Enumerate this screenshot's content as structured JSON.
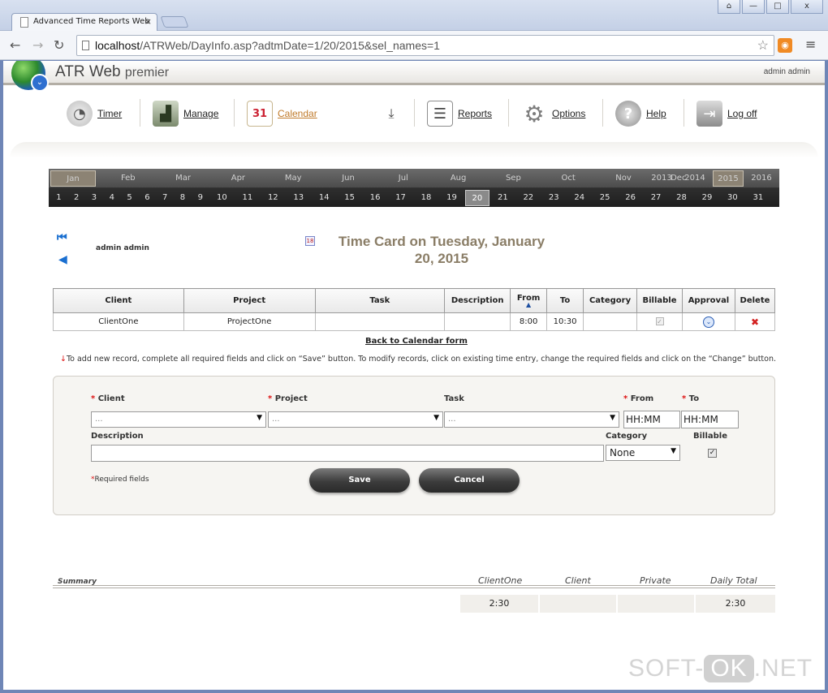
{
  "browser": {
    "tab_title": "Advanced Time Reports Web",
    "tab_close": "×",
    "url_host": "localhost",
    "url_path": "/ATRWeb/DayInfo.asp?adtmDate=1/20/2015&sel_names=1",
    "window_buttons": [
      "⌂",
      "—",
      "□",
      "x"
    ]
  },
  "app": {
    "brand": "ATR Web",
    "brand_suffix": "premier",
    "current_user": "admin admin"
  },
  "toolbar": [
    {
      "label": "Timer",
      "icon": "stopwatch-icon",
      "glyph": "◔"
    },
    {
      "label": "Manage",
      "icon": "chart-icon",
      "glyph": "▟"
    },
    {
      "label": "Calendar",
      "icon": "calendar-icon",
      "glyph": "31"
    },
    {
      "label": "",
      "icon": "download-arrow-icon",
      "glyph": "⤓"
    },
    {
      "label": "Reports",
      "icon": "report-icon",
      "glyph": "☰"
    },
    {
      "label": "Options",
      "icon": "gear-icon",
      "glyph": "⚙"
    },
    {
      "label": "Help",
      "icon": "help-icon",
      "glyph": "?"
    },
    {
      "label": "Log off",
      "icon": "logoff-icon",
      "glyph": "⇥"
    }
  ],
  "calendar": {
    "months": [
      "Jan",
      "Feb",
      "Mar",
      "Apr",
      "May",
      "Jun",
      "Jul",
      "Aug",
      "Sep",
      "Oct",
      "Nov",
      "Dec"
    ],
    "years": [
      "2013",
      "2014",
      "2015",
      "2016"
    ],
    "selected_month": "Jan",
    "selected_year": "2015",
    "days": [
      "1",
      "2",
      "3",
      "4",
      "5",
      "6",
      "7",
      "8",
      "9",
      "10",
      "11",
      "12",
      "13",
      "14",
      "15",
      "16",
      "17",
      "18",
      "19",
      "20",
      "21",
      "22",
      "23",
      "24",
      "25",
      "26",
      "27",
      "28",
      "29",
      "30",
      "31"
    ],
    "selected_day": "20"
  },
  "heading": {
    "user": "admin admin",
    "title_line1": "Time Card on Tuesday, January",
    "title_line2": "20, 2015"
  },
  "table": {
    "headers": [
      "Client",
      "Project",
      "Task",
      "Description",
      "From",
      "To",
      "Category",
      "Billable",
      "Approval",
      "Delete"
    ],
    "rows": [
      {
        "client": "ClientOne",
        "project": "ProjectOne",
        "task": "",
        "description": "",
        "from": "8:00",
        "to": "10:30",
        "category": "",
        "billable": true
      }
    ]
  },
  "back_link": "Back to Calendar form",
  "instructions": "To add new record, complete all required fields and click on “Save” button. To modify records, click on existing time entry, change the required fields and click on the “Change” button.",
  "form": {
    "client_label": "Client",
    "project_label": "Project",
    "task_label": "Task",
    "from_label": "From",
    "to_label": "To",
    "description_label": "Description",
    "category_label": "Category",
    "billable_label": "Billable",
    "client_value": "...",
    "project_value": "...",
    "task_value": "...",
    "from_value": "HH:MM",
    "to_value": "HH:MM",
    "category_value": "None",
    "billable_checked": true,
    "required_note": "Required fields",
    "save_label": "Save",
    "cancel_label": "Cancel"
  },
  "summary": {
    "label": "Summary",
    "columns": [
      "ClientOne",
      "Client",
      "Private",
      "Daily Total"
    ],
    "values": [
      "2:30",
      "",
      "",
      "2:30"
    ]
  },
  "watermark": {
    "left": "SOFT-",
    "middle": "OK",
    "right": ".NET"
  }
}
